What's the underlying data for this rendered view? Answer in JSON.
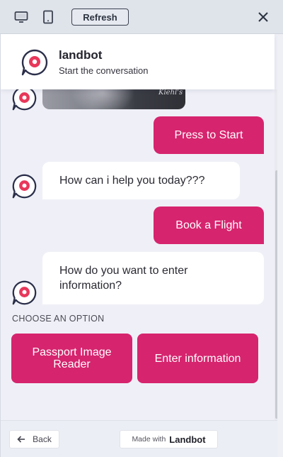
{
  "toolbar": {
    "desktop_icon": "desktop-icon",
    "tablet_icon": "tablet-icon",
    "refresh_label": "Refresh",
    "close_icon": "close-icon"
  },
  "header": {
    "title": "landbot",
    "subtitle": "Start the conversation",
    "avatar_icon": "landbot-logo"
  },
  "conversation": {
    "image_caption": "Kiehl's",
    "messages": [
      {
        "from": "user",
        "text": "Press to Start"
      },
      {
        "from": "bot",
        "text": "How can i help you today???"
      },
      {
        "from": "user",
        "text": "Book a Flight"
      },
      {
        "from": "bot",
        "text": "How do you want to enter information?"
      }
    ]
  },
  "options": {
    "label": "CHOOSE AN OPTION",
    "buttons": [
      "Passport Image Reader",
      "Enter information"
    ]
  },
  "footer": {
    "back_label": "Back",
    "made_with_text": "Made with",
    "made_with_brand": "Landbot"
  },
  "colors": {
    "accent": "#d6246e",
    "background": "#eff0f7",
    "bubble_bot": "#ffffff",
    "logo_red": "#e8375a",
    "logo_navy": "#2b2f4a"
  }
}
